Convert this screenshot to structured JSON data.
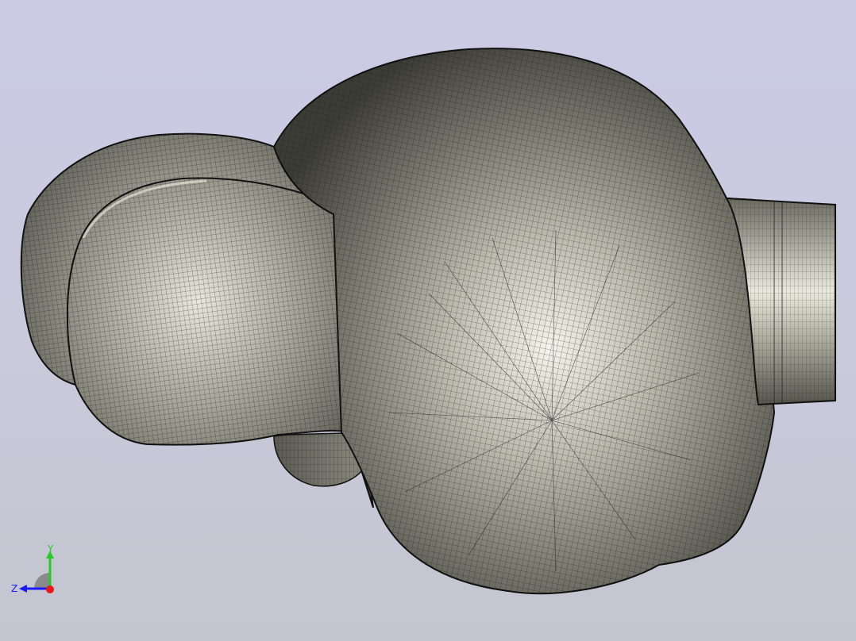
{
  "viewport": {
    "background_top": "#cbcbe6",
    "background_bottom": "#c3c5cf"
  },
  "model": {
    "surface_color": "#8e8e80",
    "mesh_line_color": "#1a1a1a",
    "highlight_color": "#f2f2e6",
    "style": "shaded-with-mesh-edges"
  },
  "triad": {
    "x_label": "",
    "y_label": "Y",
    "z_label": "Z",
    "x_color": "#e81818",
    "y_color": "#22cc22",
    "z_color": "#1a1aff"
  }
}
